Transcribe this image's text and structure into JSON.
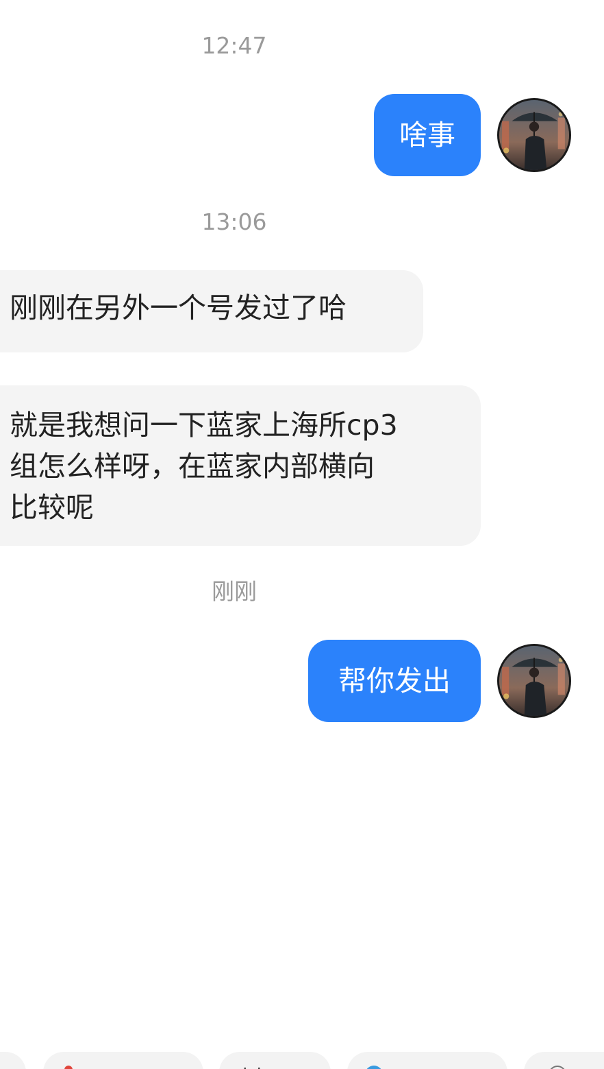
{
  "messages": [
    {
      "type": "time",
      "text": "12:47"
    },
    {
      "type": "outgoing",
      "text": "啥事"
    },
    {
      "type": "time",
      "text": "13:06"
    },
    {
      "type": "incoming",
      "text": "刚刚在另外一个号发过了哈"
    },
    {
      "type": "incoming",
      "lines": [
        "就是我想问一下蓝家上海所cp3",
        "组怎么样呀，在蓝家内部横向",
        "比较呢"
      ]
    },
    {
      "type": "time",
      "text": "刚刚"
    },
    {
      "type": "outgoing",
      "text": "帮你发出"
    }
  ],
  "colors": {
    "outgoing_bubble": "#2b82fb",
    "incoming_bubble": "#f4f4f4",
    "timestamp": "#9a9a9a",
    "background": "#ffffff"
  },
  "avatar": {
    "icon": "user-avatar-umbrella"
  },
  "quick_actions": [
    {
      "icon": "chip-icon-partial"
    },
    {
      "icon": "red-flower-icon"
    },
    {
      "icon": "cat-ears-icon"
    },
    {
      "icon": "globe-icon"
    },
    {
      "icon": "gray-circle-icon"
    }
  ]
}
